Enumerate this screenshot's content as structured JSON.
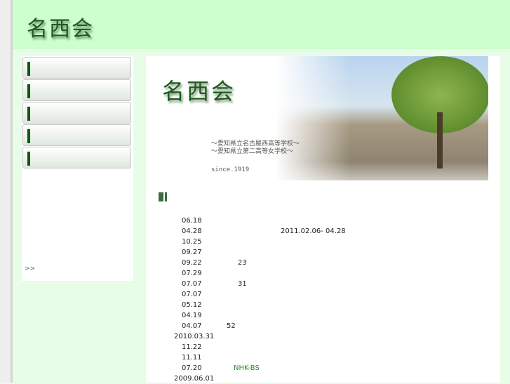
{
  "header": {
    "logo": "名西会"
  },
  "sidebar": {
    "items": [
      {
        "label": ""
      },
      {
        "label": ""
      },
      {
        "label": ""
      },
      {
        "label": ""
      },
      {
        "label": ""
      }
    ],
    "more_link": ">>"
  },
  "hero": {
    "logo": "名西会",
    "subtitle_1": "〜愛知県立名古屋西高等学校〜",
    "subtitle_2": "〜愛知県立第二高等女学校〜",
    "since": "since.1919"
  },
  "news": [
    {
      "date": "06.18",
      "text": ""
    },
    {
      "date": "04.28",
      "text": "2011.02.06- 04.28"
    },
    {
      "date": "10.25",
      "text": ""
    },
    {
      "date": "09.27",
      "text": ""
    },
    {
      "date": "09.22",
      "text": "23"
    },
    {
      "date": "07.29",
      "text": ""
    },
    {
      "date": "07.07",
      "text": "31"
    },
    {
      "date": "07.07",
      "text": ""
    },
    {
      "date": "05.12",
      "text": ""
    },
    {
      "date": "04.19",
      "text": ""
    },
    {
      "date": "04.07",
      "text": "52"
    },
    {
      "date": "2010.03.31",
      "text": ""
    },
    {
      "date": "11.22",
      "text": ""
    },
    {
      "date": "11.11",
      "text": ""
    },
    {
      "date": "07.20",
      "text": "NHK-BS"
    },
    {
      "date": "2009.06.01",
      "text": ""
    }
  ]
}
